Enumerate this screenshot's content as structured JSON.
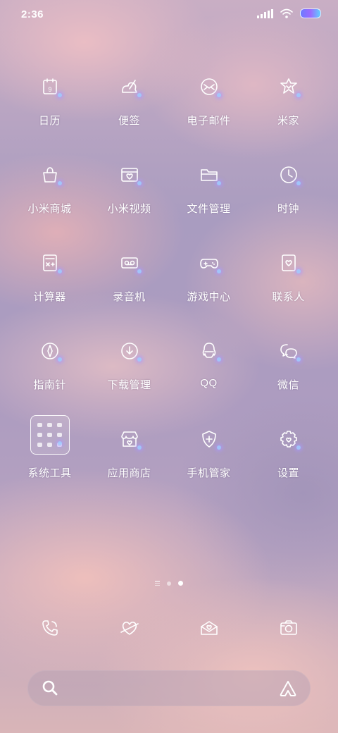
{
  "status_bar": {
    "time": "2:36",
    "icons": [
      "signal-icon",
      "wifi-icon",
      "battery-icon"
    ]
  },
  "apps": [
    {
      "label": "日历",
      "icon": "calendar-icon",
      "day": "9"
    },
    {
      "label": "便签",
      "icon": "notes-icon"
    },
    {
      "label": "电子邮件",
      "icon": "email-icon"
    },
    {
      "label": "米家",
      "icon": "mijia-icon"
    },
    {
      "label": "小米商城",
      "icon": "shopping-bag-icon"
    },
    {
      "label": "小米视频",
      "icon": "video-icon"
    },
    {
      "label": "文件管理",
      "icon": "folder-icon"
    },
    {
      "label": "时钟",
      "icon": "clock-icon"
    },
    {
      "label": "计算器",
      "icon": "calculator-icon"
    },
    {
      "label": "录音机",
      "icon": "recorder-icon"
    },
    {
      "label": "游戏中心",
      "icon": "gamepad-icon"
    },
    {
      "label": "联系人",
      "icon": "contacts-icon"
    },
    {
      "label": "指南针",
      "icon": "compass-icon"
    },
    {
      "label": "下载管理",
      "icon": "download-icon"
    },
    {
      "label": "QQ",
      "icon": "qq-icon"
    },
    {
      "label": "微信",
      "icon": "wechat-icon"
    },
    {
      "label": "系统工具",
      "icon": "folder-group-icon"
    },
    {
      "label": "应用商店",
      "icon": "app-store-icon"
    },
    {
      "label": "手机管家",
      "icon": "security-shield-icon"
    },
    {
      "label": "设置",
      "icon": "gear-icon"
    }
  ],
  "page_indicator": {
    "pages": 2,
    "active": 2
  },
  "dock": [
    {
      "icon": "phone-icon"
    },
    {
      "icon": "messages-icon"
    },
    {
      "icon": "browser-icon"
    },
    {
      "icon": "camera-icon"
    }
  ],
  "search": {
    "placeholder": "",
    "value": ""
  },
  "colors": {
    "accent_glow": "#a9b8ff",
    "battery_gradient_start": "#6b7bff",
    "battery_gradient_end": "#5fd0ff"
  }
}
